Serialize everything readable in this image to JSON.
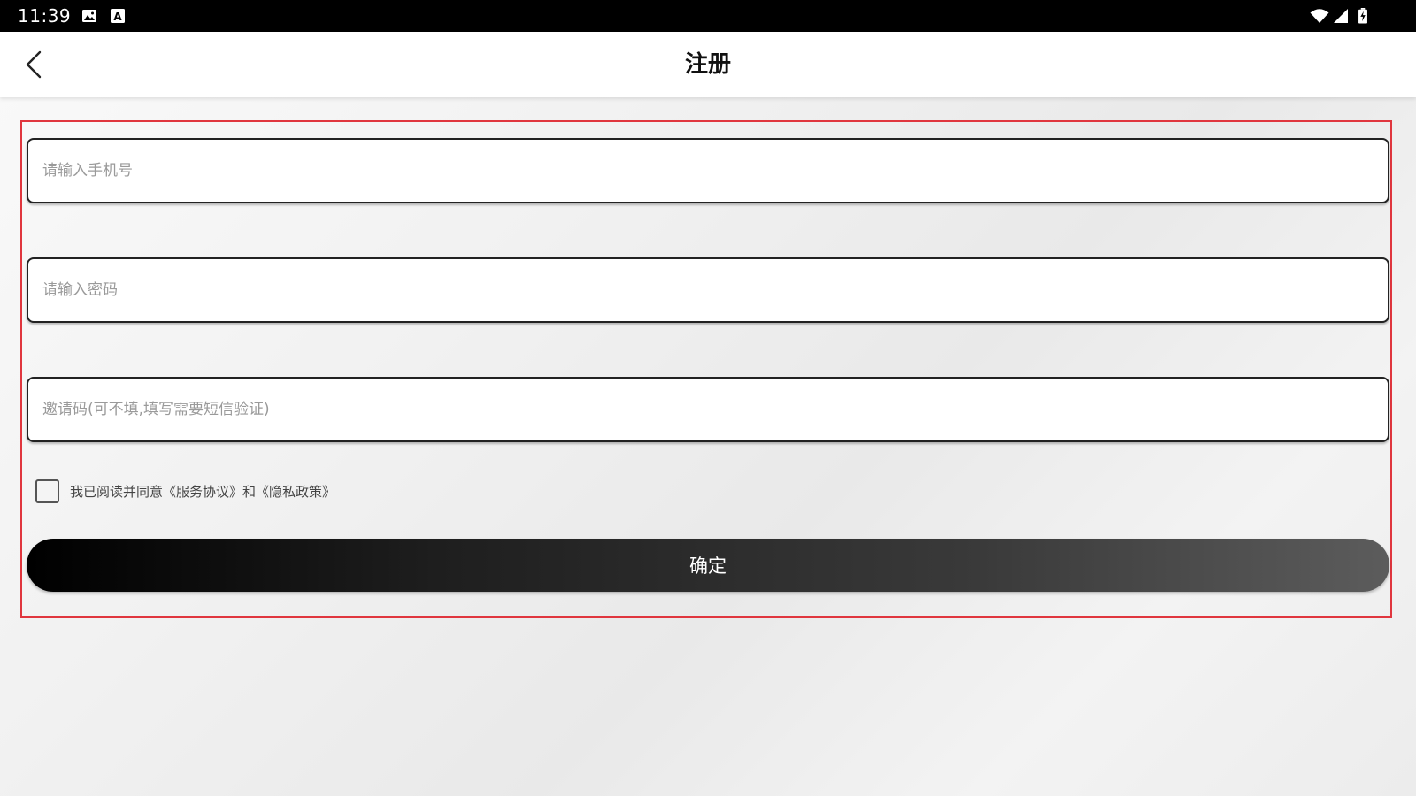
{
  "status_bar": {
    "time": "11:39",
    "left_icons": [
      "image-notification-icon",
      "font-a-notification-icon"
    ],
    "right_icons": [
      "wifi-icon",
      "cellular-signal-icon",
      "battery-charging-icon"
    ]
  },
  "header": {
    "title": "注册",
    "back_icon": "chevron-left-icon"
  },
  "form": {
    "phone": {
      "placeholder": "请输入手机号",
      "value": ""
    },
    "password": {
      "placeholder": "请输入密码",
      "value": ""
    },
    "invite": {
      "placeholder": "邀请码(可不填,填写需要短信验证)",
      "value": ""
    },
    "agreement": {
      "checked": false,
      "text": "我已阅读并同意《服务协议》和《隐私政策》"
    },
    "confirm_label": "确定"
  },
  "colors": {
    "status_bar_bg": "#000000",
    "highlight_frame": "#e0363e",
    "button_gradient_start": "#000000",
    "button_gradient_end": "#5c5c5c"
  }
}
